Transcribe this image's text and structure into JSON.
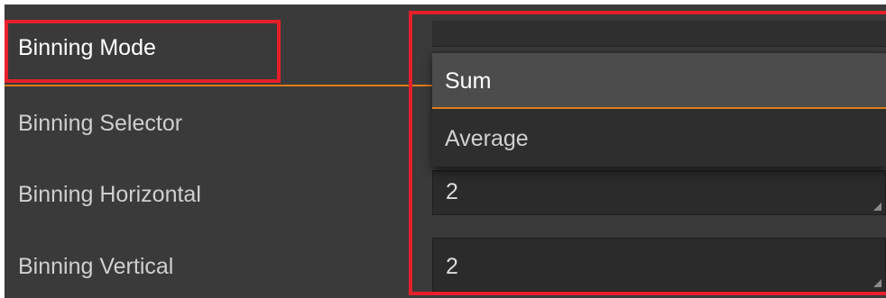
{
  "parameters": {
    "binning_mode": {
      "label": "Binning Mode"
    },
    "binning_selector": {
      "label": "Binning Selector"
    },
    "binning_horizontal": {
      "label": "Binning Horizontal",
      "value": "2"
    },
    "binning_vertical": {
      "label": "Binning Vertical",
      "value": "2"
    }
  },
  "dropdown": {
    "options": [
      {
        "label": "Sum",
        "highlighted": true
      },
      {
        "label": "Average",
        "highlighted": false
      }
    ]
  },
  "colors": {
    "accent": "#e07b1a",
    "highlight_box": "#e5202a",
    "panel_bg": "#3a3a3a"
  }
}
